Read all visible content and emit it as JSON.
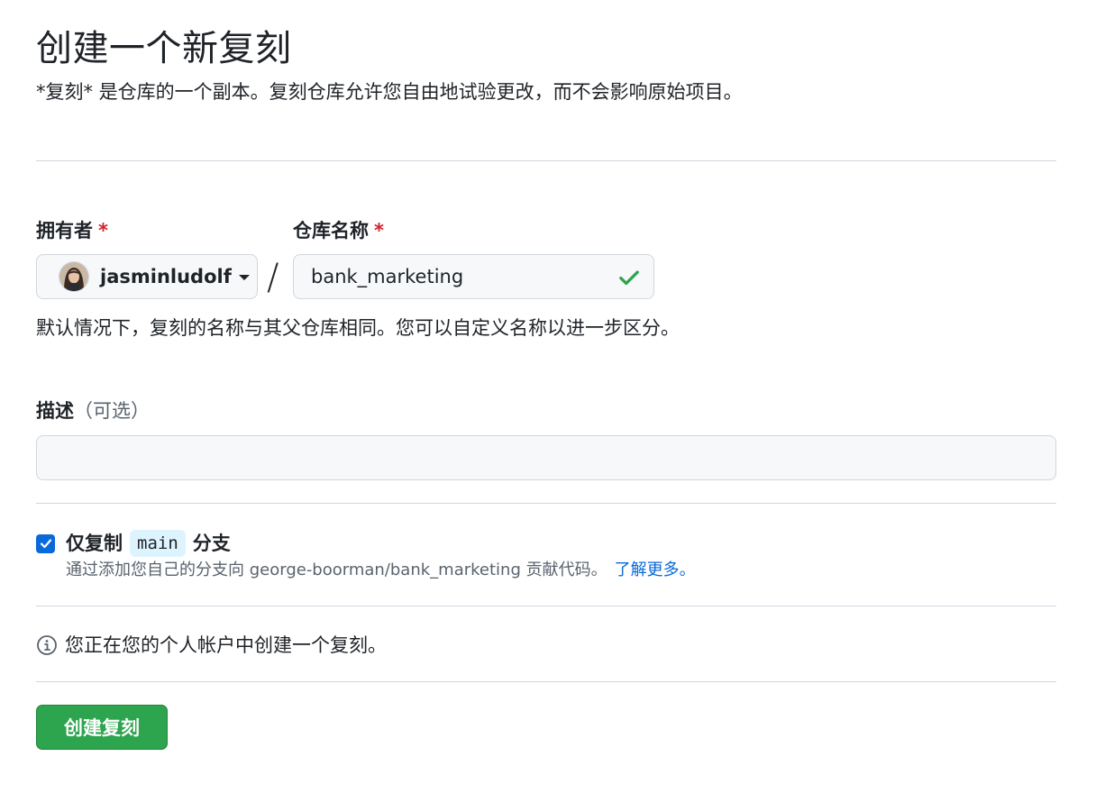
{
  "header": {
    "title": "创建一个新复刻",
    "subtitle": "*复刻* 是仓库的一个副本。复刻仓库允许您自由地试验更改，而不会影响原始项目。"
  },
  "owner": {
    "label": "拥有者",
    "required_mark": "*",
    "value": "jasminludolf"
  },
  "separator": "/",
  "repo_name": {
    "label": "仓库名称",
    "required_mark": "*",
    "value": "bank_marketing"
  },
  "name_hint": "默认情况下，复刻的名称与其父仓库相同。您可以自定义名称以进一步区分。",
  "description": {
    "label": "描述",
    "optional": "（可选）",
    "value": ""
  },
  "copy_branch": {
    "checked": true,
    "label_prefix": "仅复制",
    "branch": "main",
    "label_suffix": "分支",
    "hint": "通过添加您自己的分支向 george-boorman/bank_marketing 贡献代码。",
    "link": "了解更多。"
  },
  "info": {
    "icon": "info-icon",
    "text": "您正在您的个人帐户中创建一个复刻。"
  },
  "create_button": {
    "label": "创建复刻"
  },
  "colors": {
    "primary_button": "#2da44e",
    "checkbox": "#0969da",
    "required": "#cf222e",
    "valid": "#2da44e",
    "link": "#0969da"
  }
}
